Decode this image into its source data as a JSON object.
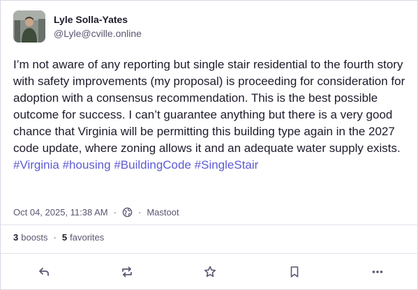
{
  "author": {
    "display_name": "Lyle Solla-Yates",
    "account": "@Lyle@cville.online"
  },
  "post": {
    "text": "I’m not aware of any reporting but single stair residential to the fourth story with safety improvements (my proposal) is proceeding for consideration for adoption with a consensus recommendation. This is the best possible outcome for success. I can’t guarantee anything but there is a very good chance that Virginia will be permitting this building type again in the 2027 code update, where zoning allows it and an adequate water supply exists.",
    "hashtags": [
      "#Virginia",
      "#housing",
      "#BuildingCode",
      "#SingleStair"
    ]
  },
  "meta": {
    "timestamp": "Oct 04, 2025, 11:38 AM",
    "separator": "·",
    "visibility_icon": "globe-icon",
    "application": "Mastoot"
  },
  "counts": {
    "boosts_number": "3",
    "boosts_label": "boosts",
    "favorites_number": "5",
    "favorites_label": "favorites"
  },
  "actions": {
    "reply_icon": "reply-icon",
    "boost_icon": "boost-icon",
    "favorite_icon": "star-icon",
    "bookmark_icon": "bookmark-icon",
    "more_icon": "more-icon"
  },
  "colors": {
    "hashtag": "#5e5bd4",
    "secondary_text": "#5c5570",
    "icon": "#5c5570"
  }
}
